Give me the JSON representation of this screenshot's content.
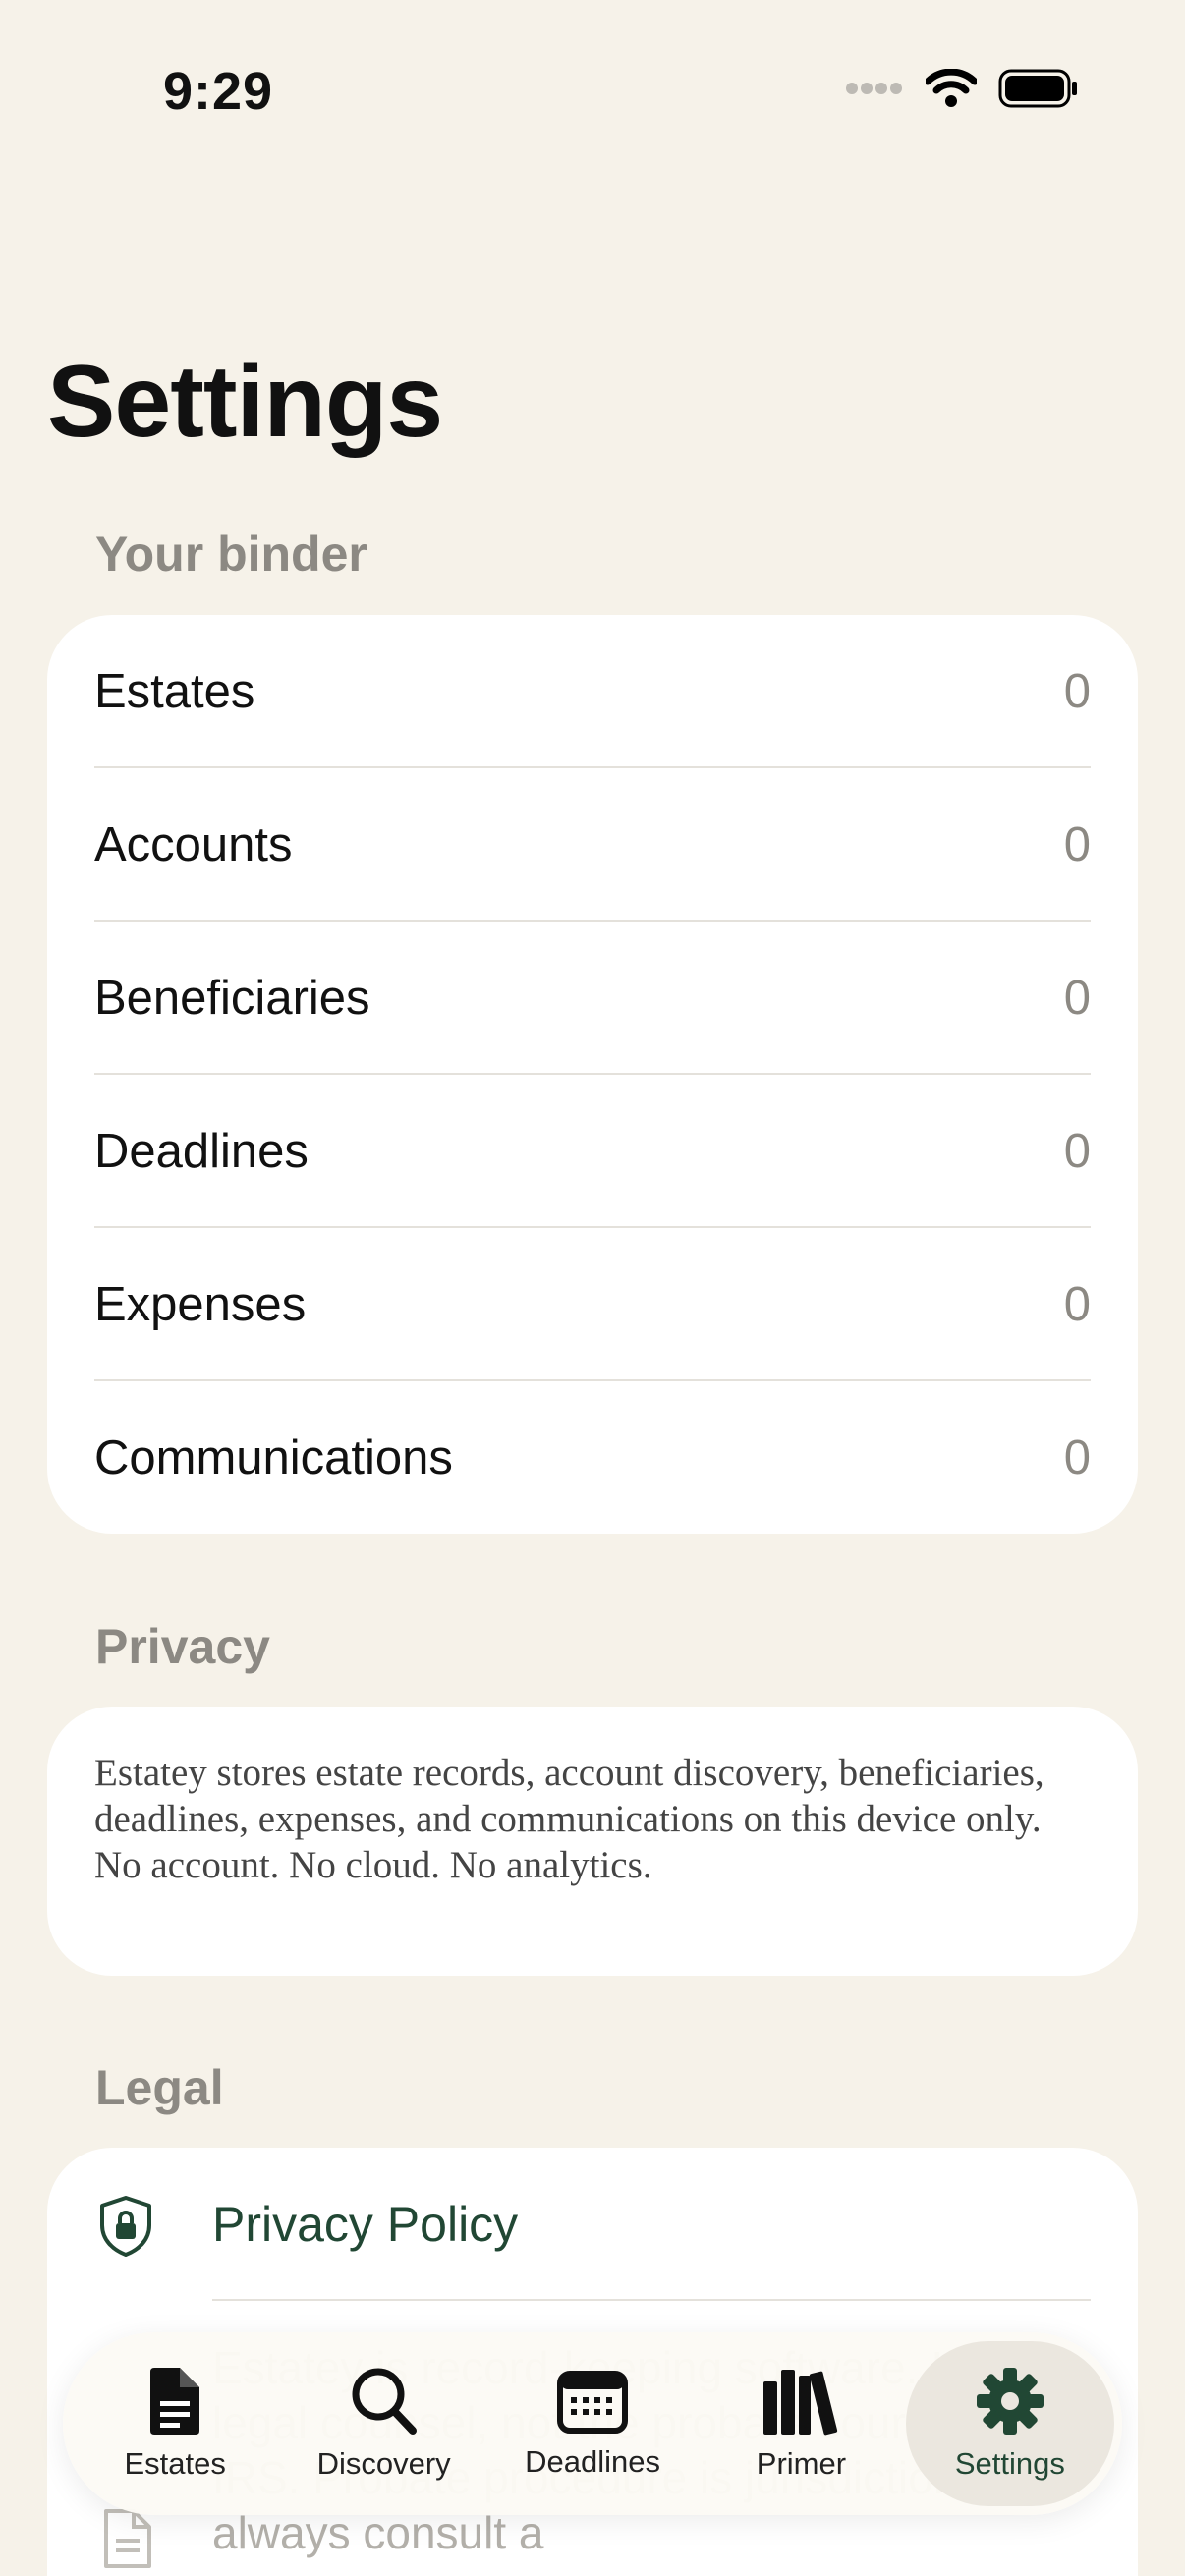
{
  "status_bar": {
    "time": "9:29"
  },
  "page": {
    "title": "Settings"
  },
  "binder": {
    "header": "Your binder",
    "rows": [
      {
        "label": "Estates",
        "value": "0"
      },
      {
        "label": "Accounts",
        "value": "0"
      },
      {
        "label": "Beneficiaries",
        "value": "0"
      },
      {
        "label": "Deadlines",
        "value": "0"
      },
      {
        "label": "Expenses",
        "value": "0"
      },
      {
        "label": "Communications",
        "value": "0"
      }
    ]
  },
  "privacy": {
    "header": "Privacy",
    "text": "Estatey stores estate records, account discovery, beneficiaries, deadlines, expenses, and communications on this device only. No account. No cloud. No analytics."
  },
  "legal": {
    "header": "Legal",
    "privacy_policy": {
      "label": "Privacy Policy",
      "icon": "shield-lock-icon"
    },
    "disclaimer": {
      "icon": "document-icon",
      "text": "Estatey is record-keeping software. It is not legal counsel, not the probate court, not the IRS. Probate procedure is jurisdictional — always consult a"
    }
  },
  "tab_bar": {
    "active": "settings",
    "tabs": [
      {
        "id": "estates",
        "label": "Estates",
        "icon": "document-icon"
      },
      {
        "id": "discovery",
        "label": "Discovery",
        "icon": "search-icon"
      },
      {
        "id": "deadlines",
        "label": "Deadlines",
        "icon": "calendar-icon"
      },
      {
        "id": "primer",
        "label": "Primer",
        "icon": "books-icon"
      },
      {
        "id": "settings",
        "label": "Settings",
        "icon": "gear-icon"
      }
    ]
  },
  "colors": {
    "background": "#f6f2e9",
    "accent": "#214734",
    "secondary_text": "#8c8983"
  }
}
